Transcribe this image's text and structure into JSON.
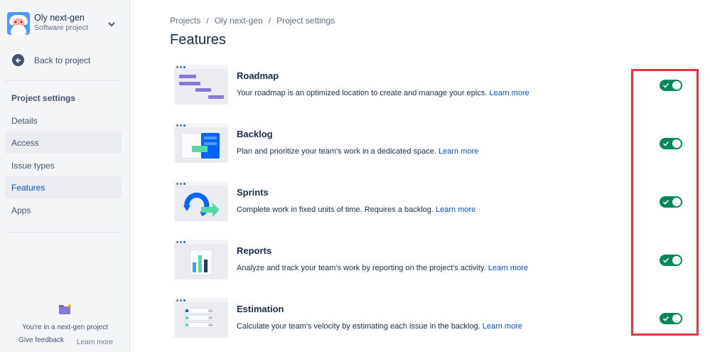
{
  "sidebar": {
    "project_name": "Oly next-gen",
    "project_type": "Software project",
    "back_label": "Back to project",
    "section_title": "Project settings",
    "items": [
      {
        "label": "Details"
      },
      {
        "label": "Access"
      },
      {
        "label": "Issue types"
      },
      {
        "label": "Features"
      },
      {
        "label": "Apps"
      }
    ],
    "active_item": "Features",
    "footer_text": "You're in a next-gen project",
    "footer_feedback": "Give feedback",
    "footer_learn": "Learn more"
  },
  "breadcrumb": [
    "Projects",
    "Oly next-gen",
    "Project settings"
  ],
  "page_title": "Features",
  "features": [
    {
      "name": "Roadmap",
      "description": "Your roadmap is an optimized location to create and manage your epics.",
      "link": "Learn more",
      "enabled": true
    },
    {
      "name": "Backlog",
      "description": "Plan and prioritize your team's work in a dedicated space.",
      "link": "Learn more",
      "enabled": true
    },
    {
      "name": "Sprints",
      "description": "Complete work in fixed units of time. Requires a backlog.",
      "link": "Learn more",
      "enabled": true
    },
    {
      "name": "Reports",
      "description": "Analyze and track your team's work by reporting on the project's activity.",
      "link": "Learn more",
      "enabled": true
    },
    {
      "name": "Estimation",
      "description": "Calculate your team's velocity by estimating each issue in the backlog.",
      "link": "Learn more",
      "enabled": true
    }
  ],
  "colors": {
    "toggle_on": "#00875a",
    "link": "#0052cc",
    "highlight": "#e5333a"
  }
}
